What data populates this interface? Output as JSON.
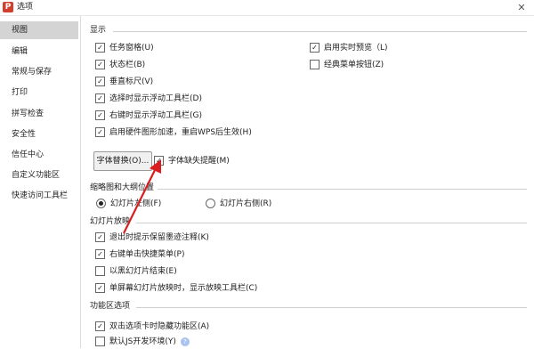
{
  "window": {
    "title": "选项",
    "logo": "P",
    "close": "✕"
  },
  "sidebar": {
    "items": [
      {
        "label": "视图"
      },
      {
        "label": "编辑"
      },
      {
        "label": "常规与保存"
      },
      {
        "label": "打印"
      },
      {
        "label": "拼写检查"
      },
      {
        "label": "安全性"
      },
      {
        "label": "信任中心"
      },
      {
        "label": "自定义功能区"
      },
      {
        "label": "快速访问工具栏"
      }
    ]
  },
  "display": {
    "heading": "显示",
    "left": [
      {
        "label": "任务窗格(U)",
        "checked": true
      },
      {
        "label": "状态栏(B)",
        "checked": true
      },
      {
        "label": "垂直标尺(V)",
        "checked": true
      },
      {
        "label": "选择时显示浮动工具栏(D)",
        "checked": true
      },
      {
        "label": "右键时显示浮动工具栏(G)",
        "checked": true
      },
      {
        "label": "启用硬件图形加速，重启WPS后生效(H)",
        "checked": true
      }
    ],
    "right": [
      {
        "label": "启用实时预览（L)",
        "checked": true
      },
      {
        "label": "经典菜单按钮(Z)",
        "checked": false
      }
    ],
    "font_replace_button": "字体替换(O)...",
    "font_missing": {
      "label": "字体缺失提醒(M)",
      "checked": true
    }
  },
  "thumbnail": {
    "heading": "缩略图和大纲位置",
    "options": [
      {
        "label": "幻灯片左侧(F)",
        "selected": true
      },
      {
        "label": "幻灯片右侧(R)",
        "selected": false
      }
    ]
  },
  "slideshow": {
    "heading": "幻灯片放映",
    "items": [
      {
        "label": "退出时提示保留墨迹注释(K)",
        "checked": true
      },
      {
        "label": "右键单击快捷菜单(P)",
        "checked": true
      },
      {
        "label": "以黑幻灯片结束(E)",
        "checked": false
      },
      {
        "label": "单屏幕幻灯片放映时，显示放映工具栏(C)",
        "checked": true
      }
    ]
  },
  "ribbon": {
    "heading": "功能区选项",
    "items": [
      {
        "label": "双击选项卡时隐藏功能区(A)",
        "checked": true
      },
      {
        "label": "默认JS开发环境(Y)",
        "checked": false
      }
    ],
    "help_glyph": "?"
  },
  "colors": {
    "accent": "#d13f2e",
    "arrow": "#d81e1e"
  }
}
